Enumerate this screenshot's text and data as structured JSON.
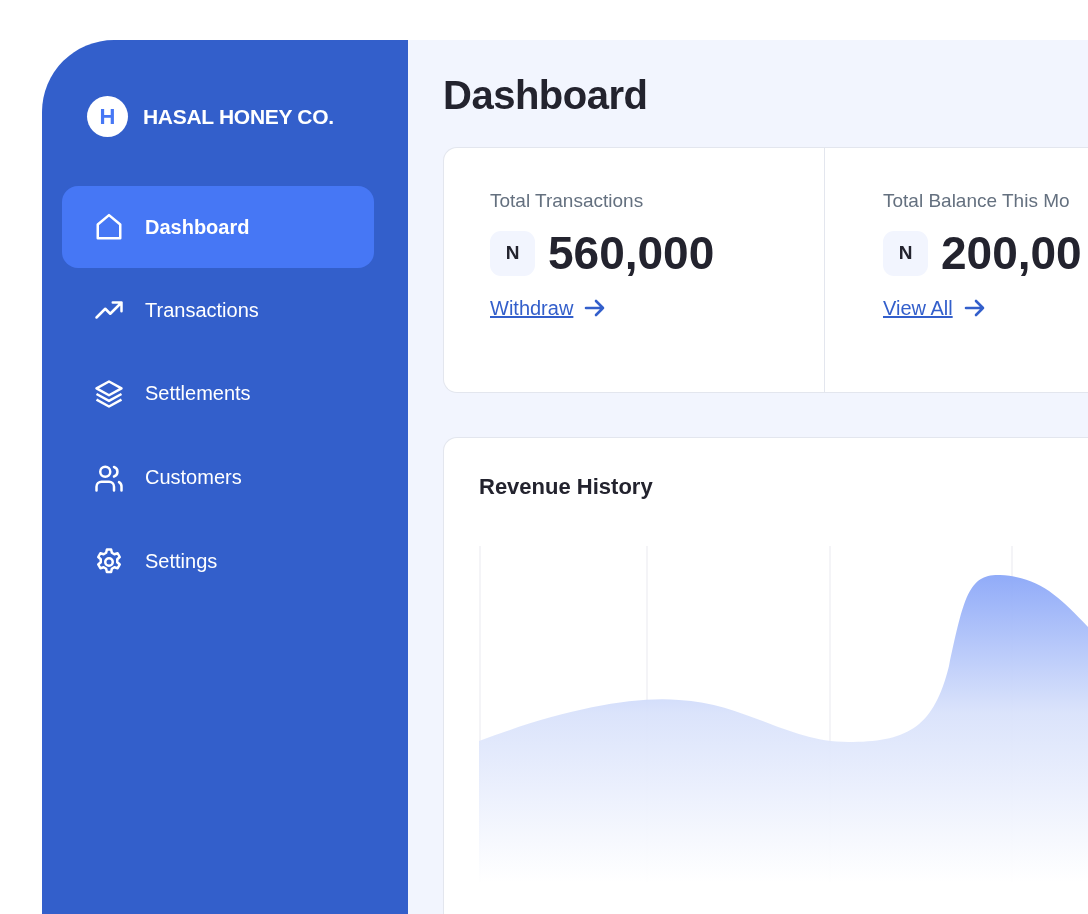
{
  "brand": {
    "initial": "H",
    "name": "HASAL HONEY CO."
  },
  "sidebar": {
    "items": [
      {
        "label": "Dashboard",
        "selected": true
      },
      {
        "label": "Transactions",
        "selected": false
      },
      {
        "label": "Settlements",
        "selected": false
      },
      {
        "label": "Customers",
        "selected": false
      },
      {
        "label": "Settings",
        "selected": false
      }
    ]
  },
  "page_title": "Dashboard",
  "stats": [
    {
      "label": "Total Transactions",
      "currency": "N",
      "amount": "560,000",
      "link": "Withdraw"
    },
    {
      "label": "Total Balance This Mo",
      "currency": "N",
      "amount": "200,00",
      "link": "View All"
    }
  ],
  "revenue": {
    "title": "Revenue History"
  }
}
